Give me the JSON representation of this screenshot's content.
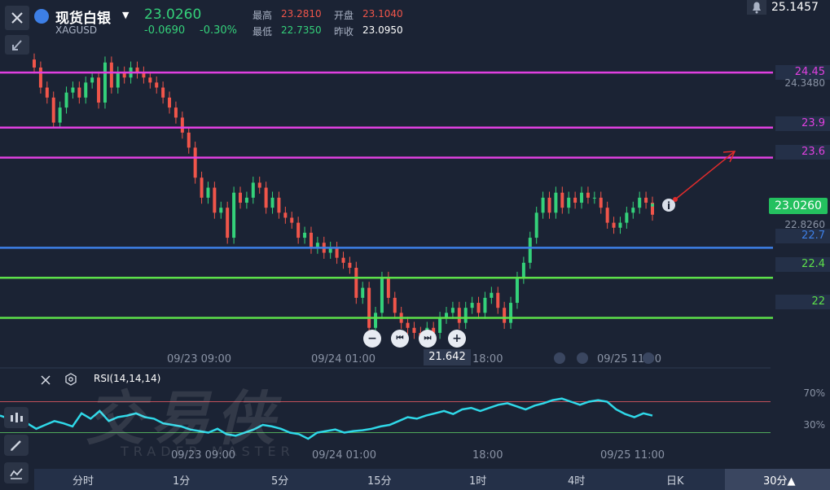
{
  "header": {
    "name": "现货白银",
    "code": "XAGUSD",
    "price": "23.0260",
    "change": "-0.0690",
    "change_pct": "-0.30%",
    "stats": [
      {
        "label": "最高",
        "value": "23.2810",
        "color": "red"
      },
      {
        "label": "开盘",
        "value": "23.1040",
        "color": "red"
      },
      {
        "label": "最低",
        "value": "22.7350",
        "color": "grn"
      },
      {
        "label": "昨收",
        "value": "23.0950",
        "color": "wht"
      }
    ]
  },
  "top_right_price": "25.1457",
  "levels": [
    {
      "label": "24.45",
      "price": 24.45,
      "color": "#e040e0"
    },
    {
      "label": "23.9",
      "price": 23.9,
      "color": "#e040e0"
    },
    {
      "label": "23.6",
      "price": 23.6,
      "color": "#e040e0"
    },
    {
      "label": "22.7",
      "price": 22.7,
      "color": "#3d7fe6"
    },
    {
      "label": "22.4",
      "price": 22.4,
      "color": "#5de04a"
    },
    {
      "label": "22",
      "price": 22.0,
      "color": "#5de04a"
    }
  ],
  "y_ticks": [
    "24.3480",
    "22.8260"
  ],
  "current_price_tag": "23.0260",
  "crosshair_value": "21.642",
  "x_ticks": [
    "09/23 09:00",
    "09/24 01:00",
    "18:00",
    "09/25 11:00"
  ],
  "rsi": {
    "title": "RSI(14,14,14)",
    "levels": [
      "70%",
      "30%"
    ]
  },
  "timeframes": [
    "分时",
    "1分",
    "5分",
    "15分",
    "1时",
    "4时",
    "日K",
    "30分▲"
  ],
  "watermark": {
    "main": "交易侠",
    "sub": "TRADER MASTER"
  },
  "chart_data": {
    "type": "candlestick",
    "ylim": [
      21.5,
      25.15
    ],
    "levels": [
      24.45,
      23.9,
      23.6,
      22.7,
      22.4,
      22.0
    ],
    "closes": [
      24.5,
      24.3,
      24.2,
      23.95,
      24.1,
      24.25,
      24.3,
      24.2,
      24.35,
      24.4,
      24.15,
      24.55,
      24.3,
      24.45,
      24.4,
      24.5,
      24.45,
      24.4,
      24.35,
      24.3,
      24.2,
      24.1,
      24.0,
      23.85,
      23.7,
      23.4,
      23.2,
      23.3,
      23.05,
      23.1,
      22.8,
      23.25,
      23.15,
      23.2,
      23.35,
      23.3,
      23.1,
      23.2,
      23.05,
      23.0,
      22.95,
      22.8,
      22.85,
      22.7,
      22.75,
      22.65,
      22.7,
      22.6,
      22.55,
      22.5,
      22.2,
      22.3,
      21.9,
      22.05,
      22.4,
      22.2,
      22.05,
      21.95,
      21.9,
      21.85,
      21.8,
      21.9,
      21.85,
      22.0,
      22.05,
      22.1,
      21.95,
      22.1,
      22.15,
      22.05,
      22.2,
      22.25,
      22.1,
      21.95,
      22.15,
      22.4,
      22.55,
      22.8,
      23.05,
      23.2,
      23.05,
      23.25,
      23.1,
      23.2,
      23.15,
      23.25,
      23.2,
      23.2,
      23.1,
      22.95,
      22.9,
      22.95,
      23.05,
      23.1,
      23.2,
      23.15,
      23.03
    ],
    "rsi": [
      52,
      48,
      50,
      42,
      35,
      40,
      45,
      42,
      38,
      55,
      48,
      58,
      45,
      50,
      52,
      55,
      50,
      48,
      42,
      40,
      38,
      34,
      32,
      30,
      35,
      28,
      26,
      30,
      34,
      40,
      38,
      35,
      30,
      28,
      22,
      30,
      32,
      34,
      30,
      32,
      33,
      35,
      38,
      40,
      45,
      50,
      48,
      52,
      55,
      58,
      54,
      60,
      62,
      58,
      62,
      66,
      68,
      64,
      60,
      65,
      68,
      72,
      74,
      70,
      66,
      70,
      72,
      70,
      60,
      54,
      50,
      55,
      52
    ]
  }
}
